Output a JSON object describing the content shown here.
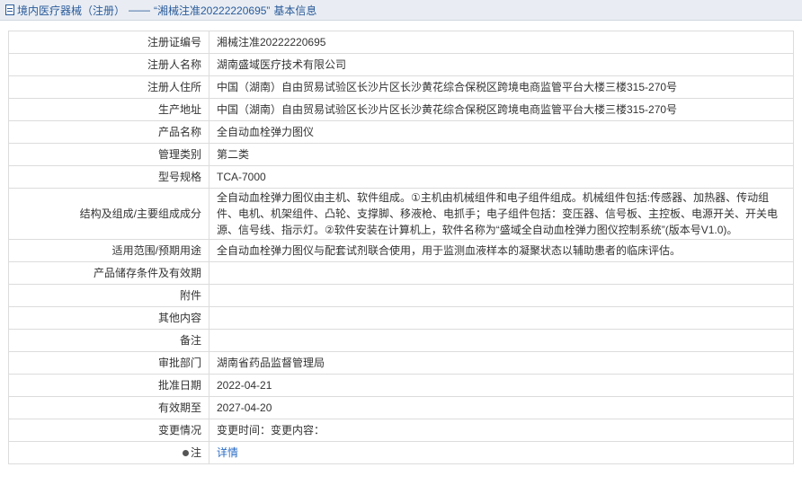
{
  "breadcrumb": {
    "section": "境内医疗器械（注册）",
    "separator": "——",
    "title": "“湘械注准20222220695”",
    "suffix": "基本信息"
  },
  "rows": [
    {
      "label": "注册证编号",
      "value": "湘械注准20222220695"
    },
    {
      "label": "注册人名称",
      "value": "湖南盛域医疗技术有限公司"
    },
    {
      "label": "注册人住所",
      "value": "中国（湖南）自由贸易试验区长沙片区长沙黄花综合保税区跨境电商监管平台大楼三楼315-270号"
    },
    {
      "label": "生产地址",
      "value": "中国（湖南）自由贸易试验区长沙片区长沙黄花综合保税区跨境电商监管平台大楼三楼315-270号"
    },
    {
      "label": "产品名称",
      "value": "全自动血栓弹力图仪"
    },
    {
      "label": "管理类别",
      "value": "第二类"
    },
    {
      "label": "型号规格",
      "value": "TCA-7000"
    },
    {
      "label": "结构及组成/主要组成成分",
      "value": "全自动血栓弹力图仪由主机、软件组成。①主机由机械组件和电子组件组成。机械组件包括:传感器、加热器、传动组件、电机、机架组件、凸轮、支撑脚、移液枪、电抓手；电子组件包括：变压器、信号板、主控板、电源开关、开关电源、信号线、指示灯。②软件安装在计算机上，软件名称为“盛域全自动血栓弹力图仪控制系统”(版本号V1.0)。"
    },
    {
      "label": "适用范围/预期用途",
      "value": "全自动血栓弹力图仪与配套试剂联合使用，用于监测血液样本的凝聚状态以辅助患者的临床评估。"
    },
    {
      "label": "产品储存条件及有效期",
      "value": ""
    },
    {
      "label": "附件",
      "value": ""
    },
    {
      "label": "其他内容",
      "value": ""
    },
    {
      "label": "备注",
      "value": ""
    },
    {
      "label": "审批部门",
      "value": "湖南省药品监督管理局"
    },
    {
      "label": "批准日期",
      "value": "2022-04-21"
    },
    {
      "label": "有效期至",
      "value": "2027-04-20"
    },
    {
      "label": "变更情况",
      "value": "变更时间：变更内容："
    }
  ],
  "note": {
    "label": "注",
    "link": "详情"
  }
}
